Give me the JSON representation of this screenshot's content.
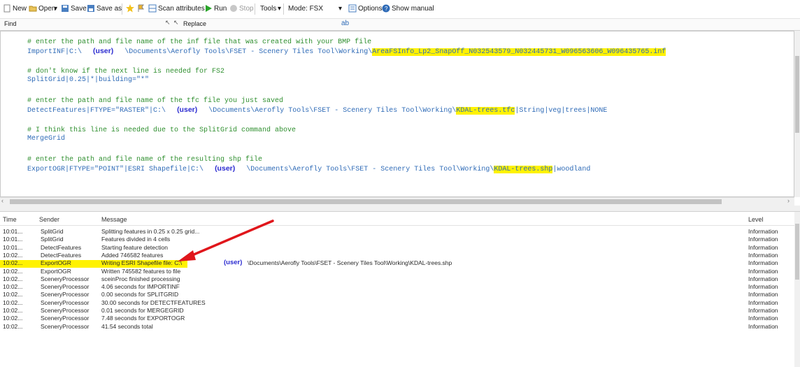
{
  "toolbar": {
    "new": "New",
    "open": "Open",
    "save": "Save",
    "save_as": "Save as",
    "scan_attributes": "Scan attributes",
    "run": "Run",
    "stop": "Stop",
    "tools": "Tools",
    "mode": "Mode: FSX",
    "options": "Options",
    "show_manual": "Show manual"
  },
  "find_bar": {
    "find_label": "Find",
    "replace_label": "Replace"
  },
  "editor": {
    "l1": "# enter the path and file name of the inf file that was created with your BMP file",
    "l2_cmd": "ImportINF|C:\\",
    "l2_user": "(user)",
    "l2_path": "\\Documents\\Aerofly Tools\\FSET - Scenery Tiles Tool\\Working\\",
    "l2_hl": "AreaFSInfo_Lp2_SnapOff_N032543579_N032445731_W096563606_W096435765.inf",
    "l3": "# don't know if the next line is needed for FS2",
    "l4": "SplitGrid|0.25|*|building=\"*\"",
    "l5": "# enter the path and file name of the tfc file you just saved",
    "l6_cmd": "DetectFeatures|FTYPE=\"RASTER\"|C:\\",
    "l6_user": "(user)",
    "l6_path": "\\Documents\\Aerofly Tools\\FSET - Scenery Tiles Tool\\Working\\",
    "l6_hl": "KDAL-trees.tfc",
    "l6_tail": "|String|veg|trees|NONE",
    "l7": "# I think this line is needed due to the SplitGrid command above",
    "l8": "MergeGrid",
    "l9": "# enter the path and file name of the resulting shp file",
    "l10_cmd": "ExportOGR|FTYPE=\"POINT\"|ESRI Shapefile|C:\\",
    "l10_user": "(user)",
    "l10_path": "\\Documents\\Aerofly Tools\\FSET - Scenery Tiles Tool\\Working\\",
    "l10_hl": "KDAL-trees.shp",
    "l10_tail": "|woodland"
  },
  "log": {
    "headers": {
      "time": "Time",
      "sender": "Sender",
      "message": "Message",
      "level": "Level"
    },
    "user_tag": "(user)",
    "rows": [
      {
        "time": "10:01...",
        "sender": "SplitGrid",
        "message": "Splitting features in 0.25 x 0.25 grid...",
        "level": "Information"
      },
      {
        "time": "10:01...",
        "sender": "SplitGrid",
        "message": "Features divided in 4 cells",
        "level": "Information"
      },
      {
        "time": "10:01...",
        "sender": "DetectFeatures",
        "message": "Starting feature detection",
        "level": "Information"
      },
      {
        "time": "10:02...",
        "sender": "DetectFeatures",
        "message": "Added 746582 features",
        "level": "Information"
      },
      {
        "time": "10:02...",
        "sender": "ExportOGR",
        "message": "Writing ESRI Shapefile file: C:\\",
        "message_tail": "\\Documents\\Aerofly Tools\\FSET - Scenery Tiles Tool\\Working\\KDAL-trees.shp",
        "level": "Information"
      },
      {
        "time": "10:02...",
        "sender": "ExportOGR",
        "message": "Written 745582 features to file",
        "level": "Information"
      },
      {
        "time": "10:02...",
        "sender": "SceneryProcessor",
        "message": "sceinProc finished processing",
        "level": "Information"
      },
      {
        "time": "10:02...",
        "sender": "SceneryProcessor",
        "message": "4.06 seconds for IMPORTINF",
        "level": "Information"
      },
      {
        "time": "10:02...",
        "sender": "SceneryProcessor",
        "message": "0.00 seconds for SPLITGRID",
        "level": "Information"
      },
      {
        "time": "10:02...",
        "sender": "SceneryProcessor",
        "message": "30.00 seconds for DETECTFEATURES",
        "level": "Information"
      },
      {
        "time": "10:02...",
        "sender": "SceneryProcessor",
        "message": "0.01 seconds for MERGEGRID",
        "level": "Information"
      },
      {
        "time": "10:02...",
        "sender": "SceneryProcessor",
        "message": "7.48 seconds for EXPORTOGR",
        "level": "Information"
      },
      {
        "time": "10:02...",
        "sender": "SceneryProcessor",
        "message": "41.54 seconds total",
        "level": "Information"
      }
    ]
  },
  "colors": {
    "highlight": "#fff200",
    "comment": "#2f8f2f",
    "command": "#2f6bb7",
    "user_tag": "#2a2ad0",
    "arrow": "#e0161b"
  }
}
